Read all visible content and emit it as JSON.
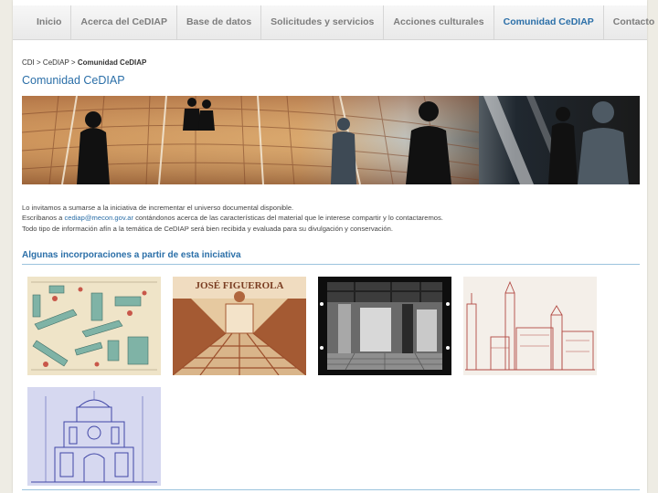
{
  "nav": {
    "items": [
      {
        "label": "Inicio"
      },
      {
        "label": "Acerca del CeDIAP"
      },
      {
        "label": "Base de datos"
      },
      {
        "label": "Solicitudes y servicios"
      },
      {
        "label": "Acciones culturales"
      },
      {
        "label": "Comunidad CeDIAP"
      },
      {
        "label": "Contacto"
      }
    ],
    "active_index": 5,
    "active_color": "#2b6fa8"
  },
  "breadcrumb": {
    "items": [
      "CDI",
      "CeDIAP",
      "Comunidad CeDIAP"
    ],
    "separator": ">"
  },
  "page_title": "Comunidad CeDIAP",
  "intro": {
    "line1": "Lo invitamos a sumarse a la iniciativa de incrementar el universo documental disponible.",
    "line2_before": "Escríbanos a ",
    "line2_email": "cediap@mecon.gov.ar",
    "line2_after": " contándonos acerca de las características del material que le interese compartir y lo contactaremos.",
    "line3": "Todo tipo de información afín a la temática de CeDIAP será bien recibida y evaluada para su divulgación y conservación."
  },
  "section_title": "Algunas incorporaciones a partir de esta iniciativa",
  "thumbnails": {
    "t2_text": "JOSÉ FIGUEROLA"
  },
  "colors": {
    "link": "#2b6fa8",
    "rule": "#9bc3dd",
    "nav_text": "#7d7d7d"
  }
}
